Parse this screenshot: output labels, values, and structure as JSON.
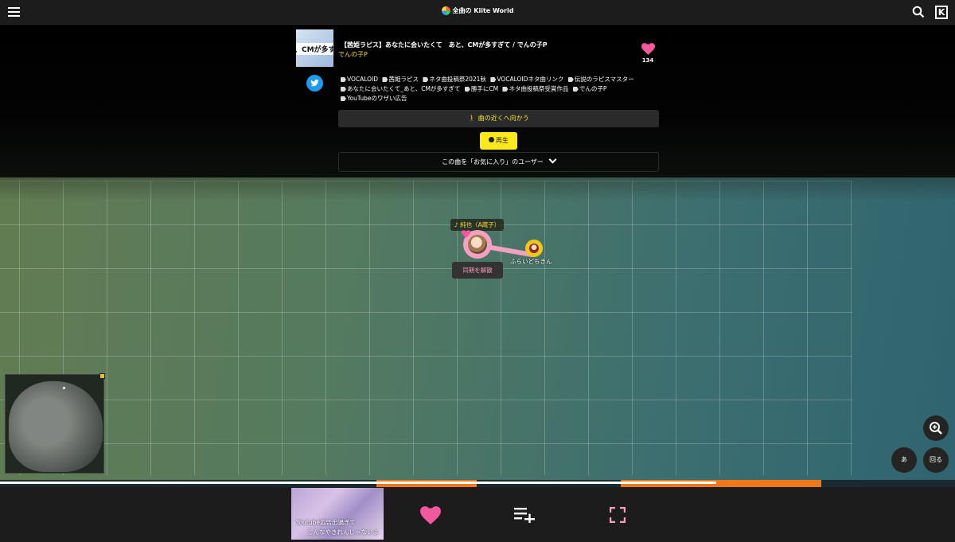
{
  "header": {
    "title": "全曲の Kiite World"
  },
  "song": {
    "thumbnail_text": "、CMが多すぎ",
    "title": "【茜姫ラピス】あなたに会いたくて　あと、CMが多すぎて / でんの子P",
    "artist": "でんの子P",
    "favorite_count": "134",
    "tags": [
      "VOCALOID",
      "茜姫ラピス",
      "ネタ曲投稿祭2021秋",
      "VOCALOIDネタ曲リンク",
      "伝説のラピスマスター",
      "あなたに会いたくて_あと、CMが多すぎて",
      "勝手にCM",
      "ネタ曲投稿祭受賞作品",
      "でんの子P",
      "YouTubeのワザい広告"
    ],
    "go_near_label": "曲の近くへ向かう",
    "play_label": "再生",
    "fav_users_label": "この曲を「お気に入り」のユーザー"
  },
  "map": {
    "now_playing_label": "♪ 純也（A蔵子）",
    "other_user": "ふらいどちきん",
    "unsync_label": "同期を解散",
    "mode_button": "あ",
    "rotate_button": "回る"
  },
  "timeline": {
    "progress": 0.75,
    "segments": [
      {
        "start": 0.394,
        "end": 0.499,
        "color": "#f07818"
      },
      {
        "start": 0.65,
        "end": 0.86,
        "color": "#f07818"
      }
    ]
  },
  "player": {
    "caption_line1": "Youtube広告出過ぎて",
    "caption_line2": "こんなやきれんじゃないよ"
  },
  "colors": {
    "accent_yellow": "#fde81b",
    "accent_pink": "#f4589c",
    "progress_orange": "#f07818"
  },
  "icons": [
    "menu-icon",
    "kiite-logo-icon",
    "search-icon",
    "kanji-icon",
    "twitter-icon",
    "heart-icon",
    "tag-icon",
    "walk-icon",
    "play-icon",
    "chevron-down-icon",
    "zoom-in-icon",
    "playlist-add-icon",
    "fullscreen-icon"
  ]
}
